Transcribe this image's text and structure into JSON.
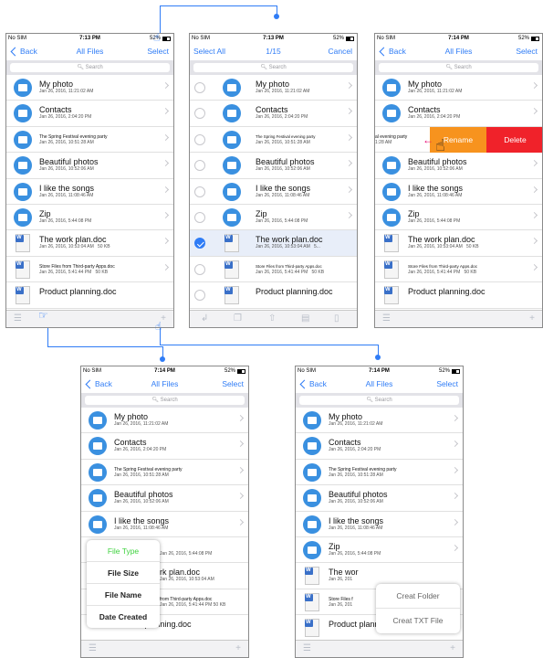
{
  "status": {
    "carrier": "No SIM",
    "battery": "52%",
    "time1": "7:13 PM",
    "time2": "7:13 PM",
    "time3": "7:14 PM",
    "time4": "7:14 PM",
    "time5": "7:14 PM"
  },
  "nav": {
    "back": "Back",
    "title": "All Files",
    "select": "Select",
    "select_all": "Select All",
    "count": "1/15",
    "cancel": "Cancel"
  },
  "search_placeholder": "Search",
  "files": [
    {
      "name": "My photo",
      "date": "Jan 26, 2016, 11:21:02 AM",
      "type": "folder"
    },
    {
      "name": "Contacts",
      "date": "Jan 26, 2016, 2:04:20 PM",
      "type": "folder"
    },
    {
      "name": "The Spring Festival evening party",
      "date": "Jan 26, 2016, 10:51:28 AM",
      "type": "folder"
    },
    {
      "name": "Beautiful photos",
      "date": "Jan 26, 2016, 10:52:06 AM",
      "type": "folder"
    },
    {
      "name": "I like the songs",
      "date": "Jan 26, 2016, 11:08:46 AM",
      "type": "folder"
    },
    {
      "name": "Zip",
      "date": "Jan 26, 2016, 5:44:08 PM",
      "type": "folder"
    },
    {
      "name": "The work plan.doc",
      "date": "Jan 26, 2016, 10:53:04 AM",
      "size": "50 KB",
      "type": "doc"
    },
    {
      "name": "Store Files from Third-party Apps.doc",
      "date": "Jan 26, 2016, 5:41:44 PM",
      "size": "50 KB",
      "type": "doc"
    },
    {
      "name": "Product planning.doc",
      "date": "",
      "type": "doc"
    }
  ],
  "selected_row_size_trunc": "5...",
  "swipe": {
    "partial_name": "al evening party",
    "partial_date": "1:28 AM",
    "rename": "Rename",
    "delete": "Delete"
  },
  "sort_menu": {
    "items": [
      "File Type",
      "File Size",
      "File Name",
      "Date Created"
    ]
  },
  "sort_partial": {
    "songs": "I like the songs",
    "songs_date": "Jan 26, 2016, 11:08:46 AM",
    "zip_date": "Jan 26, 2016, 5:44:08 PM",
    "workplan": "rk plan.doc",
    "workplan_date": "Jan 26, 2016, 10:53:04 AM",
    "third": "from Third-party Apps.doc",
    "third_date": "Jan 26, 2016, 5:41:44 PM   50 KB"
  },
  "add_menu": {
    "items": [
      "Creat Folder",
      "Creat TXT File"
    ]
  },
  "add_partial": {
    "workplan": "The wor",
    "workplan_date": "Jan 26, 201",
    "third": "Store Files f",
    "third_date": "Jan 26, 201"
  },
  "icons": {
    "back": "chevron-left-icon",
    "sort": "list-sort-icon",
    "add": "plus-icon",
    "wifi": "wifi-icon",
    "battery": "battery-icon"
  },
  "colors": {
    "accent": "#2f7cf6",
    "rename": "#f7931e",
    "delete": "#f0222a",
    "menu_active": "#3fd23f",
    "pointer": "#e8006e"
  }
}
